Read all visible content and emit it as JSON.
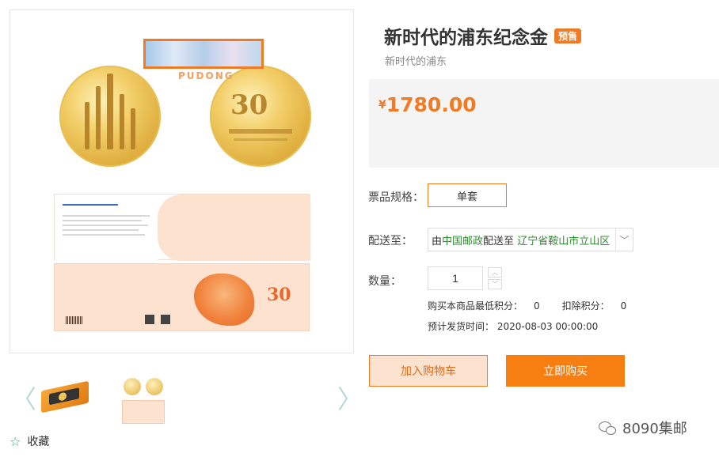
{
  "product": {
    "title": "新时代的浦东纪念金",
    "badge": "预售",
    "subtitle": "新时代的浦东",
    "price_currency": "¥",
    "price_value": "1780.00"
  },
  "spec": {
    "label": "票品规格：",
    "option": "单套"
  },
  "shipping": {
    "label": "配送至：",
    "prefix": "由",
    "carrier": "中国邮政",
    "middle": "配送至",
    "destination": "辽宁省鞍山市立山区"
  },
  "quantity": {
    "label": "数量：",
    "value": "1"
  },
  "points": {
    "min_label": "购买本商品最低积分：",
    "min_value": "0",
    "deduct_label": "扣除积分：",
    "deduct_value": "0"
  },
  "delivery": {
    "label": "预计发货时间：",
    "time": "2020-08-03 00:00:00"
  },
  "buttons": {
    "add_to_cart": "加入购物车",
    "buy_now": "立即购买"
  },
  "gallery": {
    "prev": "〈",
    "next": "〉",
    "pudong_word": "PUDONG",
    "coin_number": "30"
  },
  "favorite": {
    "label": "收藏"
  },
  "watermark": {
    "text": "8090集邮"
  },
  "colors": {
    "accent": "#f07b26",
    "buy_button": "#f77f12",
    "carrier_green": "#2e8b2e"
  }
}
